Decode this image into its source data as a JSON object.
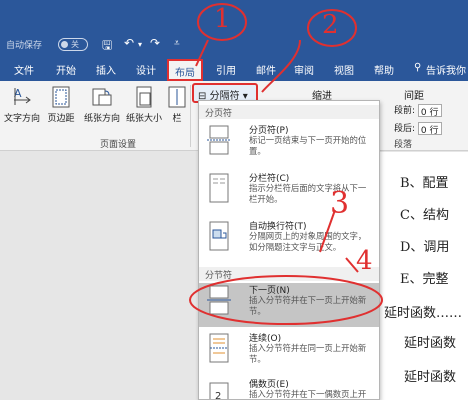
{
  "quick_access": {
    "autosave_label": "自动保存",
    "toggle_state": "关"
  },
  "tabs": [
    "文件",
    "开始",
    "插入",
    "设计",
    "布局",
    "引用",
    "邮件",
    "审阅",
    "视图",
    "帮助",
    "告诉我你"
  ],
  "active_tab": "布局",
  "ribbon": {
    "text_direction": "文字方向",
    "margins": "页边距",
    "orientation": "纸张方向",
    "size": "纸张大小",
    "columns": "栏",
    "page_setup_group": "页面设置",
    "breaks_button": "分隔符",
    "indent_label": "缩进",
    "spacing_label": "间距",
    "before_label": "段前:",
    "after_label": "段后:",
    "before_value": "0 行",
    "after_value": "0 行",
    "paragraph_group": "段落"
  },
  "dropdown": {
    "page_breaks_head": "分页符",
    "section_breaks_head": "分节符",
    "items": [
      {
        "title": "分页符(P)",
        "desc": "标记一页结束与下一页开始的位置。"
      },
      {
        "title": "分栏符(C)",
        "desc": "指示分栏符后面的文字将从下一栏开始。"
      },
      {
        "title": "自动换行符(T)",
        "desc": "分隔网页上的对象周围的文字，如分隔题注文字与正文。"
      },
      {
        "title": "下一页(N)",
        "desc": "插入分节符并在下一页上开始新节。"
      },
      {
        "title": "连续(O)",
        "desc": "插入分节符并在同一页上开始新节。"
      },
      {
        "title": "偶数页(E)",
        "desc": "插入分节符并在下一偶数页上开始新节。"
      }
    ]
  },
  "document_lines": [
    "B、配置",
    "C、结构",
    "D、调用",
    "E、完整",
    "延时函数……",
    "延时函数",
    "延时函数"
  ],
  "annotations": [
    "1",
    "2",
    "3",
    "4"
  ],
  "colors": {
    "ribbon_blue": "#2b579a",
    "annotation_red": "#e03030"
  }
}
